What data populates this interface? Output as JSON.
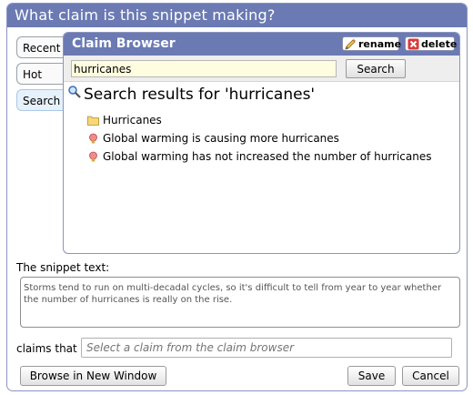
{
  "window": {
    "title": "What claim is this snippet making?"
  },
  "side_tabs": [
    {
      "label": "Recent",
      "active": false
    },
    {
      "label": "Hot",
      "active": false
    },
    {
      "label": "Search",
      "active": true
    }
  ],
  "claim_browser": {
    "title": "Claim Browser",
    "rename_label": "rename",
    "delete_label": "delete",
    "search_value": "hurricanes",
    "search_button": "Search",
    "results_title": "Search results for 'hurricanes'",
    "results": [
      {
        "label": "Hurricanes",
        "icon": "folder-icon"
      },
      {
        "label": "Global warming is causing more hurricanes",
        "icon": "claim-bulb-icon"
      },
      {
        "label": "Global warming has not increased the number of hurricanes",
        "icon": "claim-bulb-icon"
      }
    ]
  },
  "snippet": {
    "label": "The snippet text:",
    "text": "Storms tend to run on multi-decadal cycles, so it's difficult to tell from year to year whether the number of hurricanes is really on the rise."
  },
  "claims": {
    "label": "claims that",
    "placeholder": "Select a claim from the claim browser"
  },
  "buttons": {
    "browse_new_window": "Browse in New Window",
    "save": "Save",
    "cancel": "Cancel"
  },
  "colors": {
    "header_bg": "#6b7ab3",
    "search_input_bg": "#fffde0",
    "active_tab_bg": "#e6f1fb"
  }
}
